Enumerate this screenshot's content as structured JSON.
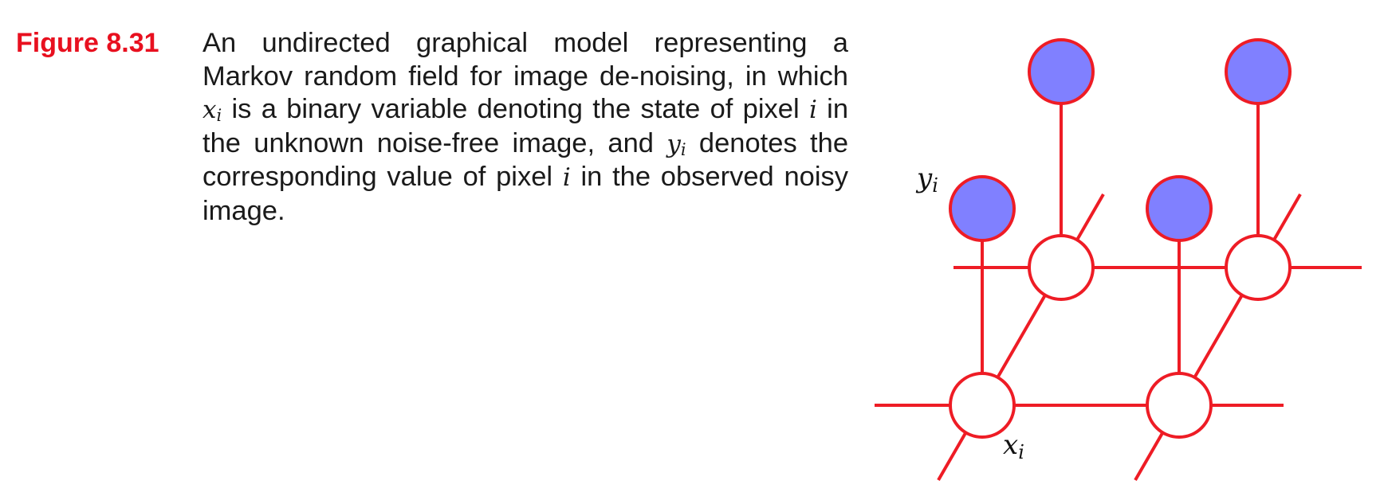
{
  "caption": {
    "figure_label": "Figure 8.31",
    "part1": "An undirected graphical model representing a Markov random field for image de-noising, in which ",
    "xi": "x",
    "sub_i": "i",
    "part2": " is a binary variable denoting the state of pixel ",
    "i": "i",
    "part3": " in the unknown noise-free image, and ",
    "yi": "y",
    "part4": " denotes the corresponding value of pixel ",
    "part5": " in the observed noisy image."
  },
  "diagram": {
    "labels": {
      "y_label": "y",
      "x_label": "x",
      "subscript": "i"
    },
    "colors": {
      "edge": "#ee1c25",
      "observed_fill": "#8080ff",
      "latent_fill": "#ffffff"
    },
    "nodes": [
      {
        "id": "x-front-left",
        "kind": "latent"
      },
      {
        "id": "x-front-right",
        "kind": "latent"
      },
      {
        "id": "x-back-left",
        "kind": "latent"
      },
      {
        "id": "x-back-right",
        "kind": "latent"
      },
      {
        "id": "y-front-left",
        "kind": "observed"
      },
      {
        "id": "y-front-right",
        "kind": "observed"
      },
      {
        "id": "y-back-left",
        "kind": "observed"
      },
      {
        "id": "y-back-right",
        "kind": "observed"
      }
    ]
  }
}
